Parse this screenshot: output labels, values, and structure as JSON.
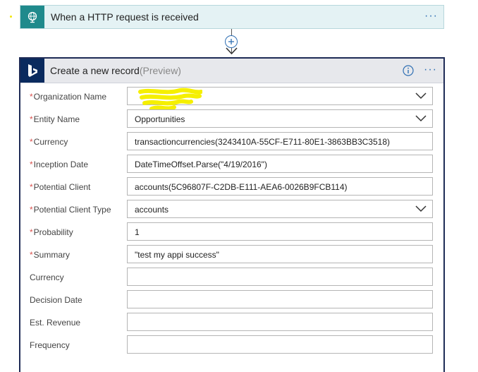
{
  "trigger": {
    "title": "When a HTTP request is received"
  },
  "action": {
    "title": "Create a new record",
    "preview": "(Preview)"
  },
  "more_glyph": "···",
  "fields": [
    {
      "label": "Organization Name",
      "required": true,
      "value": "",
      "dropdown": true,
      "redacted": true
    },
    {
      "label": "Entity Name",
      "required": true,
      "value": "Opportunities",
      "dropdown": true
    },
    {
      "label": "Currency",
      "required": true,
      "value": "transactioncurrencies(3243410A-55CF-E711-80E1-3863BB3C3518)"
    },
    {
      "label": "Inception Date",
      "required": true,
      "value": "DateTimeOffset.Parse(\"4/19/2016\")"
    },
    {
      "label": "Potential Client",
      "required": true,
      "value": "accounts(5C96807F-C2DB-E111-AEA6-0026B9FCB114)"
    },
    {
      "label": "Potential Client Type",
      "required": true,
      "value": "accounts",
      "dropdown": true
    },
    {
      "label": "Probability",
      "required": true,
      "value": "1"
    },
    {
      "label": "Summary",
      "required": true,
      "value": "\"test my appi success\""
    },
    {
      "label": "Currency",
      "required": false,
      "value": ""
    },
    {
      "label": "Decision Date",
      "required": false,
      "value": ""
    },
    {
      "label": "Est. Revenue",
      "required": false,
      "value": ""
    },
    {
      "label": "Frequency",
      "required": false,
      "value": ""
    }
  ],
  "colors": {
    "trigger_accent": "#1f8a8c",
    "action_accent": "#0a2a5e",
    "link_blue": "#2f6fb3",
    "required_red": "#d9534f"
  }
}
